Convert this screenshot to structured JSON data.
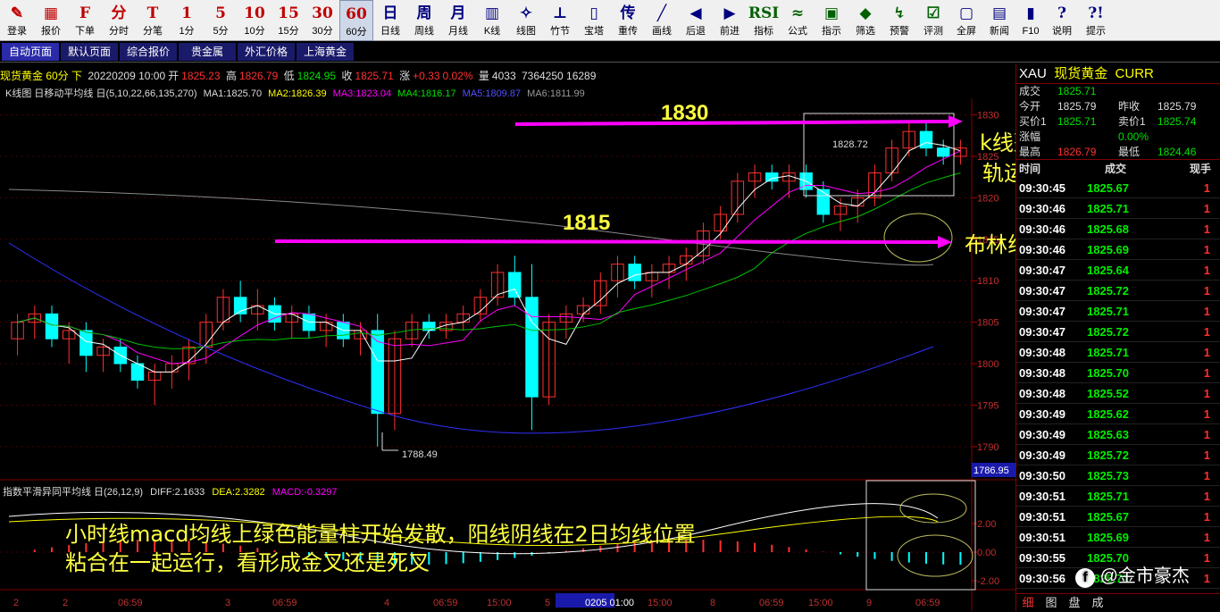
{
  "toolbar": [
    {
      "icon": "✎",
      "label": "登录",
      "name": "login"
    },
    {
      "icon": "▦",
      "label": "报价",
      "name": "quote"
    },
    {
      "icon": "F",
      "label": "下单",
      "name": "order"
    },
    {
      "icon": "分",
      "label": "分时",
      "name": "timeshare"
    },
    {
      "icon": "T",
      "label": "分笔",
      "name": "tick"
    },
    {
      "icon": "1",
      "label": "1分",
      "name": "1min"
    },
    {
      "icon": "5",
      "label": "5分",
      "name": "5min"
    },
    {
      "icon": "10",
      "label": "10分",
      "name": "10min"
    },
    {
      "icon": "15",
      "label": "15分",
      "name": "15min"
    },
    {
      "icon": "30",
      "label": "30分",
      "name": "30min"
    },
    {
      "icon": "60",
      "label": "60分",
      "name": "60min"
    },
    {
      "icon": "日",
      "label": "日线",
      "name": "daily"
    },
    {
      "icon": "周",
      "label": "周线",
      "name": "weekly"
    },
    {
      "icon": "月",
      "label": "月线",
      "name": "monthly"
    },
    {
      "icon": "▥",
      "label": "K线",
      "name": "kline"
    },
    {
      "icon": "✧",
      "label": "线图",
      "name": "linechart"
    },
    {
      "icon": "⊥",
      "label": "竹节",
      "name": "bamboo"
    },
    {
      "icon": "▯",
      "label": "宝塔",
      "name": "tower"
    },
    {
      "icon": "传",
      "label": "重传",
      "name": "resend"
    },
    {
      "icon": "╱",
      "label": "画线",
      "name": "draw"
    },
    {
      "icon": "◀",
      "label": "后退",
      "name": "back"
    },
    {
      "icon": "▶",
      "label": "前进",
      "name": "forward"
    },
    {
      "icon": "RSI",
      "label": "指标",
      "name": "indicator"
    },
    {
      "icon": "≈",
      "label": "公式",
      "name": "formula"
    },
    {
      "icon": "▣",
      "label": "指示",
      "name": "hint"
    },
    {
      "icon": "◆",
      "label": "筛选",
      "name": "filter"
    },
    {
      "icon": "↯",
      "label": "预警",
      "name": "alert"
    },
    {
      "icon": "☑",
      "label": "评测",
      "name": "evaluate"
    },
    {
      "icon": "▢",
      "label": "全屏",
      "name": "fullscreen"
    },
    {
      "icon": "▤",
      "label": "新闻",
      "name": "news"
    },
    {
      "icon": "▮",
      "label": "F10",
      "name": "f10"
    },
    {
      "icon": "?",
      "label": "说明",
      "name": "help-desc"
    },
    {
      "icon": "?!",
      "label": "提示",
      "name": "tips"
    }
  ],
  "tabs": [
    "自动页面",
    "默认页面",
    "综合报价",
    "贵金属",
    "外汇价格",
    "上海黄金"
  ],
  "info": {
    "instrument": "现货黄金 60分 下",
    "date": "20220209 10:00",
    "open_label": "开",
    "open": "1825.23",
    "high_label": "高",
    "high": "1826.79",
    "low_label": "低",
    "low": "1824.95",
    "close_label": "收",
    "close": "1825.71",
    "change_label": "涨",
    "change": "+0.33",
    "change_pct": "0.02%",
    "vol_label": "量",
    "vol": "4033",
    "extra": "7364250 16289"
  },
  "ma": {
    "head": "K线图 日移动平均线 日(5,10,22,66,135,270)",
    "ma1": "MA1:1825.70",
    "ma2": "MA2:1826.39",
    "ma3": "MA3:1823.04",
    "ma4": "MA4:1816.17",
    "ma5": "MA5:1809.87",
    "ma6": "MA6:1811.99"
  },
  "macd_info": {
    "head": "指数平滑异同平均线 日(26,12,9)",
    "diff": "DIFF:2.1633",
    "dea": "DEA:2.3282",
    "macd": "MACD:-0.3297"
  },
  "price_axis": [
    "1830",
    "1825",
    "1820",
    "1815",
    "1810",
    "1805",
    "1800",
    "1795",
    "1790"
  ],
  "price_current": "1786.95",
  "macd_axis": [
    "2.00",
    "0.00",
    "-2.00"
  ],
  "time_axis": [
    "2",
    "2",
    "06:59",
    "3",
    "06:59",
    "4",
    "06:59",
    "15:00",
    "5",
    "0205 01:00",
    "15:00",
    "8",
    "06:59",
    "15:00",
    "9",
    "06:59"
  ],
  "labels": {
    "low": "1788.49",
    "high": "1828.72"
  },
  "annotations": {
    "level_high": "1830",
    "level_mid": "1815",
    "note1": "k线整体在布林线上",
    "note1b": "轨运行",
    "note2": "布林线向上发散运行",
    "note3a": "小时线macd均线上绿色能量柱开始发散，阳线阴线在2日均线位置",
    "note3b": "粘合在一起运行，看形成金叉还是死叉"
  },
  "side": {
    "code": "XAU",
    "name": "现货黄金",
    "curr": "CURR",
    "deal_label": "成交",
    "deal": "1825.71",
    "open_label": "今开",
    "open": "1825.79",
    "prev_label": "昨收",
    "prev": "1825.79",
    "buy_label": "买价1",
    "buy": "1825.71",
    "sell_label": "卖价1",
    "sell": "1825.74",
    "high_label": "最高",
    "high": "1826.79",
    "low_label": "最低",
    "low": "1824.46",
    "rise_label": "涨幅",
    "rise": "0.00%",
    "col_time": "时间",
    "col_deal": "成交",
    "col_hand": "现手",
    "trades": [
      [
        "09:30:45",
        "1825.67",
        "1"
      ],
      [
        "09:30:46",
        "1825.71",
        "1"
      ],
      [
        "09:30:46",
        "1825.68",
        "1"
      ],
      [
        "09:30:46",
        "1825.69",
        "1"
      ],
      [
        "09:30:47",
        "1825.64",
        "1"
      ],
      [
        "09:30:47",
        "1825.72",
        "1"
      ],
      [
        "09:30:47",
        "1825.71",
        "1"
      ],
      [
        "09:30:47",
        "1825.72",
        "1"
      ],
      [
        "09:30:48",
        "1825.71",
        "1"
      ],
      [
        "09:30:48",
        "1825.70",
        "1"
      ],
      [
        "09:30:48",
        "1825.52",
        "1"
      ],
      [
        "09:30:49",
        "1825.62",
        "1"
      ],
      [
        "09:30:49",
        "1825.63",
        "1"
      ],
      [
        "09:30:49",
        "1825.72",
        "1"
      ],
      [
        "09:30:50",
        "1825.73",
        "1"
      ],
      [
        "09:30:51",
        "1825.71",
        "1"
      ],
      [
        "09:30:51",
        "1825.67",
        "1"
      ],
      [
        "09:30:51",
        "1825.69",
        "1"
      ],
      [
        "09:30:55",
        "1825.70",
        "1"
      ],
      [
        "09:30:56",
        "1825.71",
        "1"
      ]
    ],
    "bottom_tabs": [
      "细",
      "图",
      "盘",
      "成"
    ],
    "watermark": "@金市豪杰"
  },
  "colors": {
    "up": "#ff3030",
    "down": "#00ffff",
    "ma_white": "#ffffff",
    "ma_yellow": "#ffff00",
    "ma_magenta": "#ff00ff",
    "ma_green": "#00c000",
    "ma_blue": "#3030ff",
    "ma_gray": "#888888",
    "arrow": "#ff00ff",
    "note": "#ffff40"
  },
  "chart_data": {
    "type": "candlestick",
    "title": "现货黄金 60分",
    "ylim": [
      1786,
      1832
    ],
    "candles": [
      [
        1803,
        1806,
        1801,
        1805
      ],
      [
        1805,
        1807,
        1803,
        1806
      ],
      [
        1806,
        1807,
        1802,
        1803
      ],
      [
        1803,
        1805,
        1800,
        1804
      ],
      [
        1804,
        1805,
        1799,
        1801
      ],
      [
        1801,
        1803,
        1799,
        1802
      ],
      [
        1802,
        1803,
        1799,
        1800
      ],
      [
        1800,
        1801,
        1797,
        1798
      ],
      [
        1798,
        1800,
        1795,
        1799
      ],
      [
        1799,
        1801,
        1797,
        1800
      ],
      [
        1800,
        1803,
        1798,
        1802
      ],
      [
        1802,
        1806,
        1800,
        1805
      ],
      [
        1805,
        1809,
        1804,
        1808
      ],
      [
        1808,
        1810,
        1805,
        1806
      ],
      [
        1806,
        1809,
        1804,
        1807
      ],
      [
        1807,
        1808,
        1804,
        1805
      ],
      [
        1805,
        1807,
        1803,
        1806
      ],
      [
        1806,
        1807,
        1803,
        1804
      ],
      [
        1804,
        1806,
        1802,
        1805
      ],
      [
        1805,
        1806,
        1802,
        1803
      ],
      [
        1803,
        1805,
        1801,
        1804
      ],
      [
        1804,
        1806,
        1790,
        1794
      ],
      [
        1794,
        1804,
        1792,
        1803
      ],
      [
        1803,
        1806,
        1802,
        1805
      ],
      [
        1805,
        1806,
        1803,
        1804
      ],
      [
        1804,
        1806,
        1803,
        1805
      ],
      [
        1805,
        1807,
        1804,
        1806
      ],
      [
        1806,
        1809,
        1805,
        1808
      ],
      [
        1808,
        1812,
        1807,
        1811
      ],
      [
        1811,
        1813,
        1807,
        1808
      ],
      [
        1808,
        1812,
        1792,
        1796
      ],
      [
        1796,
        1806,
        1795,
        1805
      ],
      [
        1805,
        1807,
        1803,
        1806
      ],
      [
        1806,
        1808,
        1805,
        1807
      ],
      [
        1807,
        1811,
        1806,
        1810
      ],
      [
        1810,
        1813,
        1808,
        1812
      ],
      [
        1812,
        1813,
        1809,
        1810
      ],
      [
        1810,
        1812,
        1808,
        1811
      ],
      [
        1811,
        1813,
        1809,
        1812
      ],
      [
        1812,
        1814,
        1810,
        1813
      ],
      [
        1813,
        1817,
        1812,
        1816
      ],
      [
        1816,
        1819,
        1815,
        1818
      ],
      [
        1818,
        1823,
        1817,
        1822
      ],
      [
        1822,
        1824,
        1820,
        1823
      ],
      [
        1823,
        1824,
        1821,
        1822
      ],
      [
        1822,
        1824,
        1820,
        1823
      ],
      [
        1823,
        1824,
        1820,
        1821
      ],
      [
        1821,
        1822,
        1817,
        1818
      ],
      [
        1818,
        1820,
        1816,
        1819
      ],
      [
        1819,
        1821,
        1817,
        1820
      ],
      [
        1820,
        1824,
        1819,
        1823
      ],
      [
        1823,
        1827,
        1822,
        1826
      ],
      [
        1826,
        1829,
        1825,
        1828
      ],
      [
        1828,
        1829,
        1825,
        1826
      ],
      [
        1826,
        1827,
        1824,
        1825
      ],
      [
        1825,
        1827,
        1824,
        1826
      ]
    ]
  }
}
